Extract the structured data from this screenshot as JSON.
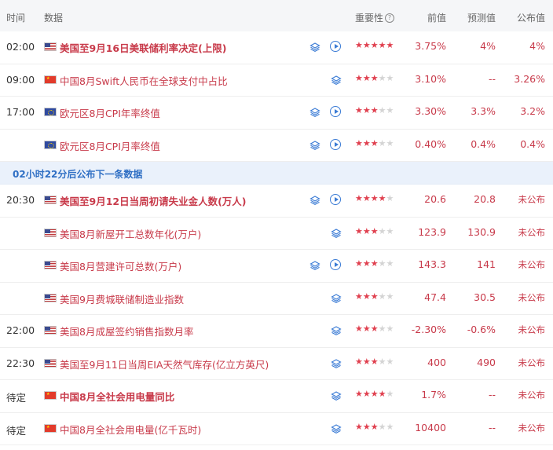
{
  "header": {
    "time": "时间",
    "data": "数据",
    "importance": "重要性",
    "importance_help_icon": "question-icon",
    "previous": "前值",
    "forecast": "预测值",
    "actual": "公布值"
  },
  "banner": {
    "text": "02小时22分后公布下一条数据"
  },
  "colors": {
    "accent_red": "#c83a4a",
    "star_on": "#e0404f",
    "star_off": "#d4d4d4",
    "banner_bg": "#eaf1fb",
    "banner_text": "#2f6fc4"
  },
  "rows": [
    {
      "time": "02:00",
      "flag": "us",
      "name": "美国至9月16日美联储利率决定(上限)",
      "bold": true,
      "play": true,
      "stars": 5,
      "previous": "3.75%",
      "forecast": "4%",
      "actual": "4%"
    },
    {
      "time": "09:00",
      "flag": "cn",
      "name": "中国8月Swift人民币在全球支付中占比",
      "bold": false,
      "play": false,
      "stars": 3,
      "previous": "3.10%",
      "forecast": "--",
      "actual": "3.26%"
    },
    {
      "time": "17:00",
      "flag": "eu",
      "name": "欧元区8月CPI年率终值",
      "bold": false,
      "play": true,
      "stars": 3,
      "previous": "3.30%",
      "forecast": "3.3%",
      "actual": "3.2%"
    },
    {
      "time": "",
      "flag": "eu",
      "name": "欧元区8月CPI月率终值",
      "bold": false,
      "play": true,
      "stars": 3,
      "previous": "0.40%",
      "forecast": "0.4%",
      "actual": "0.4%"
    },
    {
      "time": "20:30",
      "flag": "us",
      "name": "美国至9月12日当周初请失业金人数(万人)",
      "bold": true,
      "play": true,
      "stars": 4,
      "previous": "20.6",
      "forecast": "20.8",
      "actual": "未公布"
    },
    {
      "time": "",
      "flag": "us",
      "name": "美国8月新屋开工总数年化(万户)",
      "bold": false,
      "play": false,
      "stars": 3,
      "previous": "123.9",
      "forecast": "130.9",
      "actual": "未公布"
    },
    {
      "time": "",
      "flag": "us",
      "name": "美国8月营建许可总数(万户)",
      "bold": false,
      "play": true,
      "stars": 3,
      "previous": "143.3",
      "forecast": "141",
      "actual": "未公布"
    },
    {
      "time": "",
      "flag": "us",
      "name": "美国9月费城联储制造业指数",
      "bold": false,
      "play": false,
      "stars": 3,
      "previous": "47.4",
      "forecast": "30.5",
      "actual": "未公布"
    },
    {
      "time": "22:00",
      "flag": "us",
      "name": "美国8月成屋签约销售指数月率",
      "bold": false,
      "play": false,
      "stars": 3,
      "previous": "-2.30%",
      "forecast": "-0.6%",
      "actual": "未公布"
    },
    {
      "time": "22:30",
      "flag": "us",
      "name": "美国至9月11日当周EIA天然气库存(亿立方英尺)",
      "bold": false,
      "play": false,
      "stars": 3,
      "previous": "400",
      "forecast": "490",
      "actual": "未公布"
    },
    {
      "time": "待定",
      "flag": "cn",
      "name": "中国8月全社会用电量同比",
      "bold": true,
      "play": false,
      "stars": 4,
      "previous": "1.7%",
      "forecast": "--",
      "actual": "未公布"
    },
    {
      "time": "待定",
      "flag": "cn",
      "name": "中国8月全社会用电量(亿千瓦时)",
      "bold": false,
      "play": false,
      "stars": 3,
      "previous": "10400",
      "forecast": "--",
      "actual": "未公布"
    }
  ]
}
